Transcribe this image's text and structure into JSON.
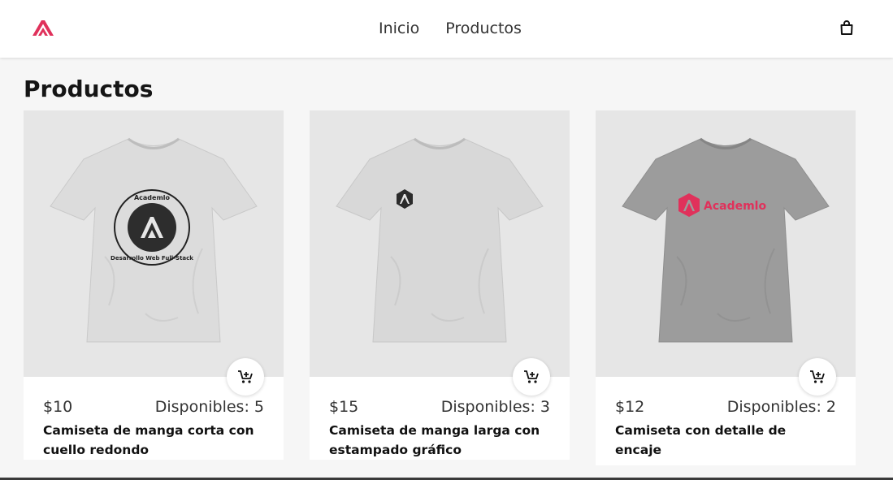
{
  "header": {
    "nav": [
      "Inicio",
      "Productos"
    ],
    "brand_color": "#e0315b"
  },
  "page": {
    "title": "Productos"
  },
  "products": [
    {
      "price": "$10",
      "stock": "Disponibles: 5",
      "name": "Camiseta de manga corta con cuello redondo",
      "shirt_color": "#d9d9d9",
      "print": {
        "top": "Academlo",
        "bottom": "Desarrollo Web Full-Stack"
      }
    },
    {
      "price": "$15",
      "stock": "Disponibles: 3",
      "name": "Camiseta de manga larga con estampado gráfico",
      "shirt_color": "#d6d6d6"
    },
    {
      "price": "$12",
      "stock": "Disponibles: 2",
      "name": "Camiseta con detalle de encaje",
      "shirt_color": "#9c9c9c",
      "print": {
        "brand": "Academlo"
      }
    }
  ],
  "icons": {
    "logo": "academlo-logo-icon",
    "bag": "shopping-bag-icon",
    "add_to_cart": "cart-plus-icon"
  }
}
